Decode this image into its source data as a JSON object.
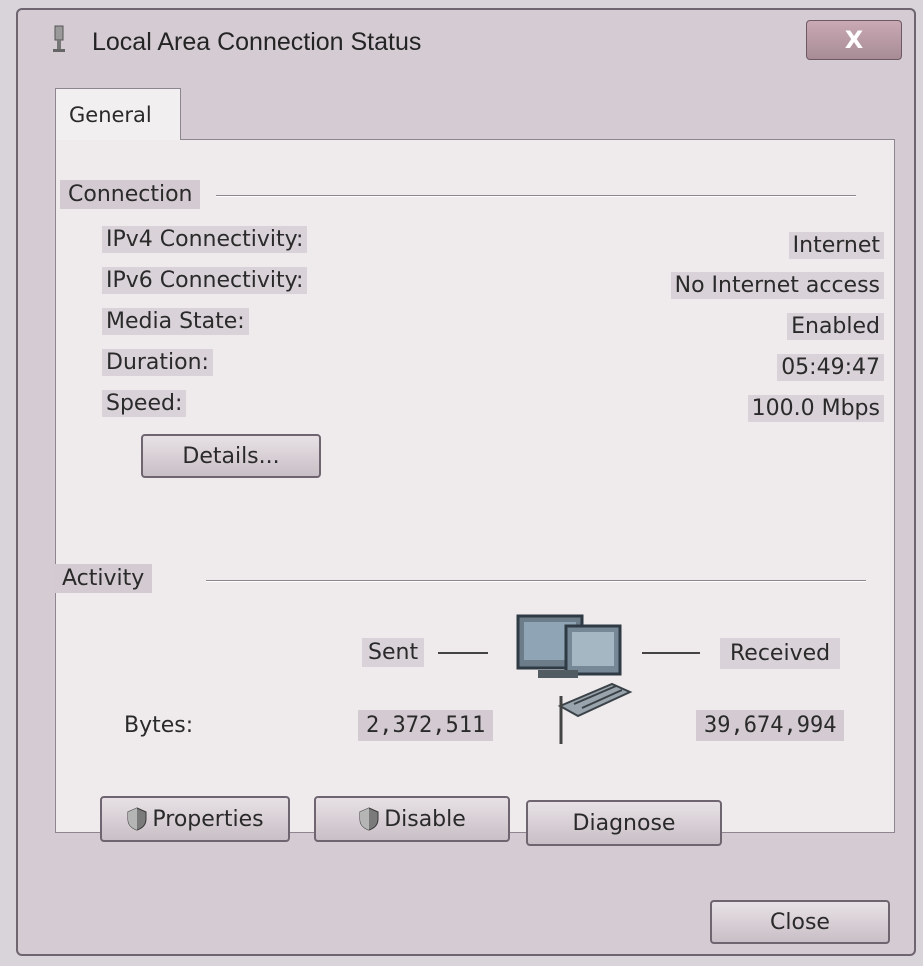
{
  "window": {
    "title": "Local Area Connection Status",
    "close_glyph": "X"
  },
  "tabs": [
    {
      "label": "General",
      "selected": true
    }
  ],
  "connection": {
    "heading": "Connection",
    "rows": [
      {
        "label": "IPv4 Connectivity:",
        "value": "Internet"
      },
      {
        "label": "IPv6 Connectivity:",
        "value": "No Internet access"
      },
      {
        "label": "Media State:",
        "value": "Enabled"
      },
      {
        "label": "Duration:",
        "value": "05:49:47"
      },
      {
        "label": "Speed:",
        "value": "100.0 Mbps"
      }
    ],
    "details_button": "Details..."
  },
  "activity": {
    "heading": "Activity",
    "sent_label": "Sent",
    "received_label": "Received",
    "bytes_label": "Bytes:",
    "bytes_sent": "2,372,511",
    "bytes_received": "39,674,994",
    "icon": "network-computers-icon"
  },
  "buttons": {
    "properties": "Properties",
    "disable": "Disable",
    "diagnose": "Diagnose",
    "close": "Close"
  },
  "colors": {
    "window_bg": "#d4cbd3",
    "panel_bg": "#efebed",
    "label_highlight": "#d9d2d8"
  }
}
